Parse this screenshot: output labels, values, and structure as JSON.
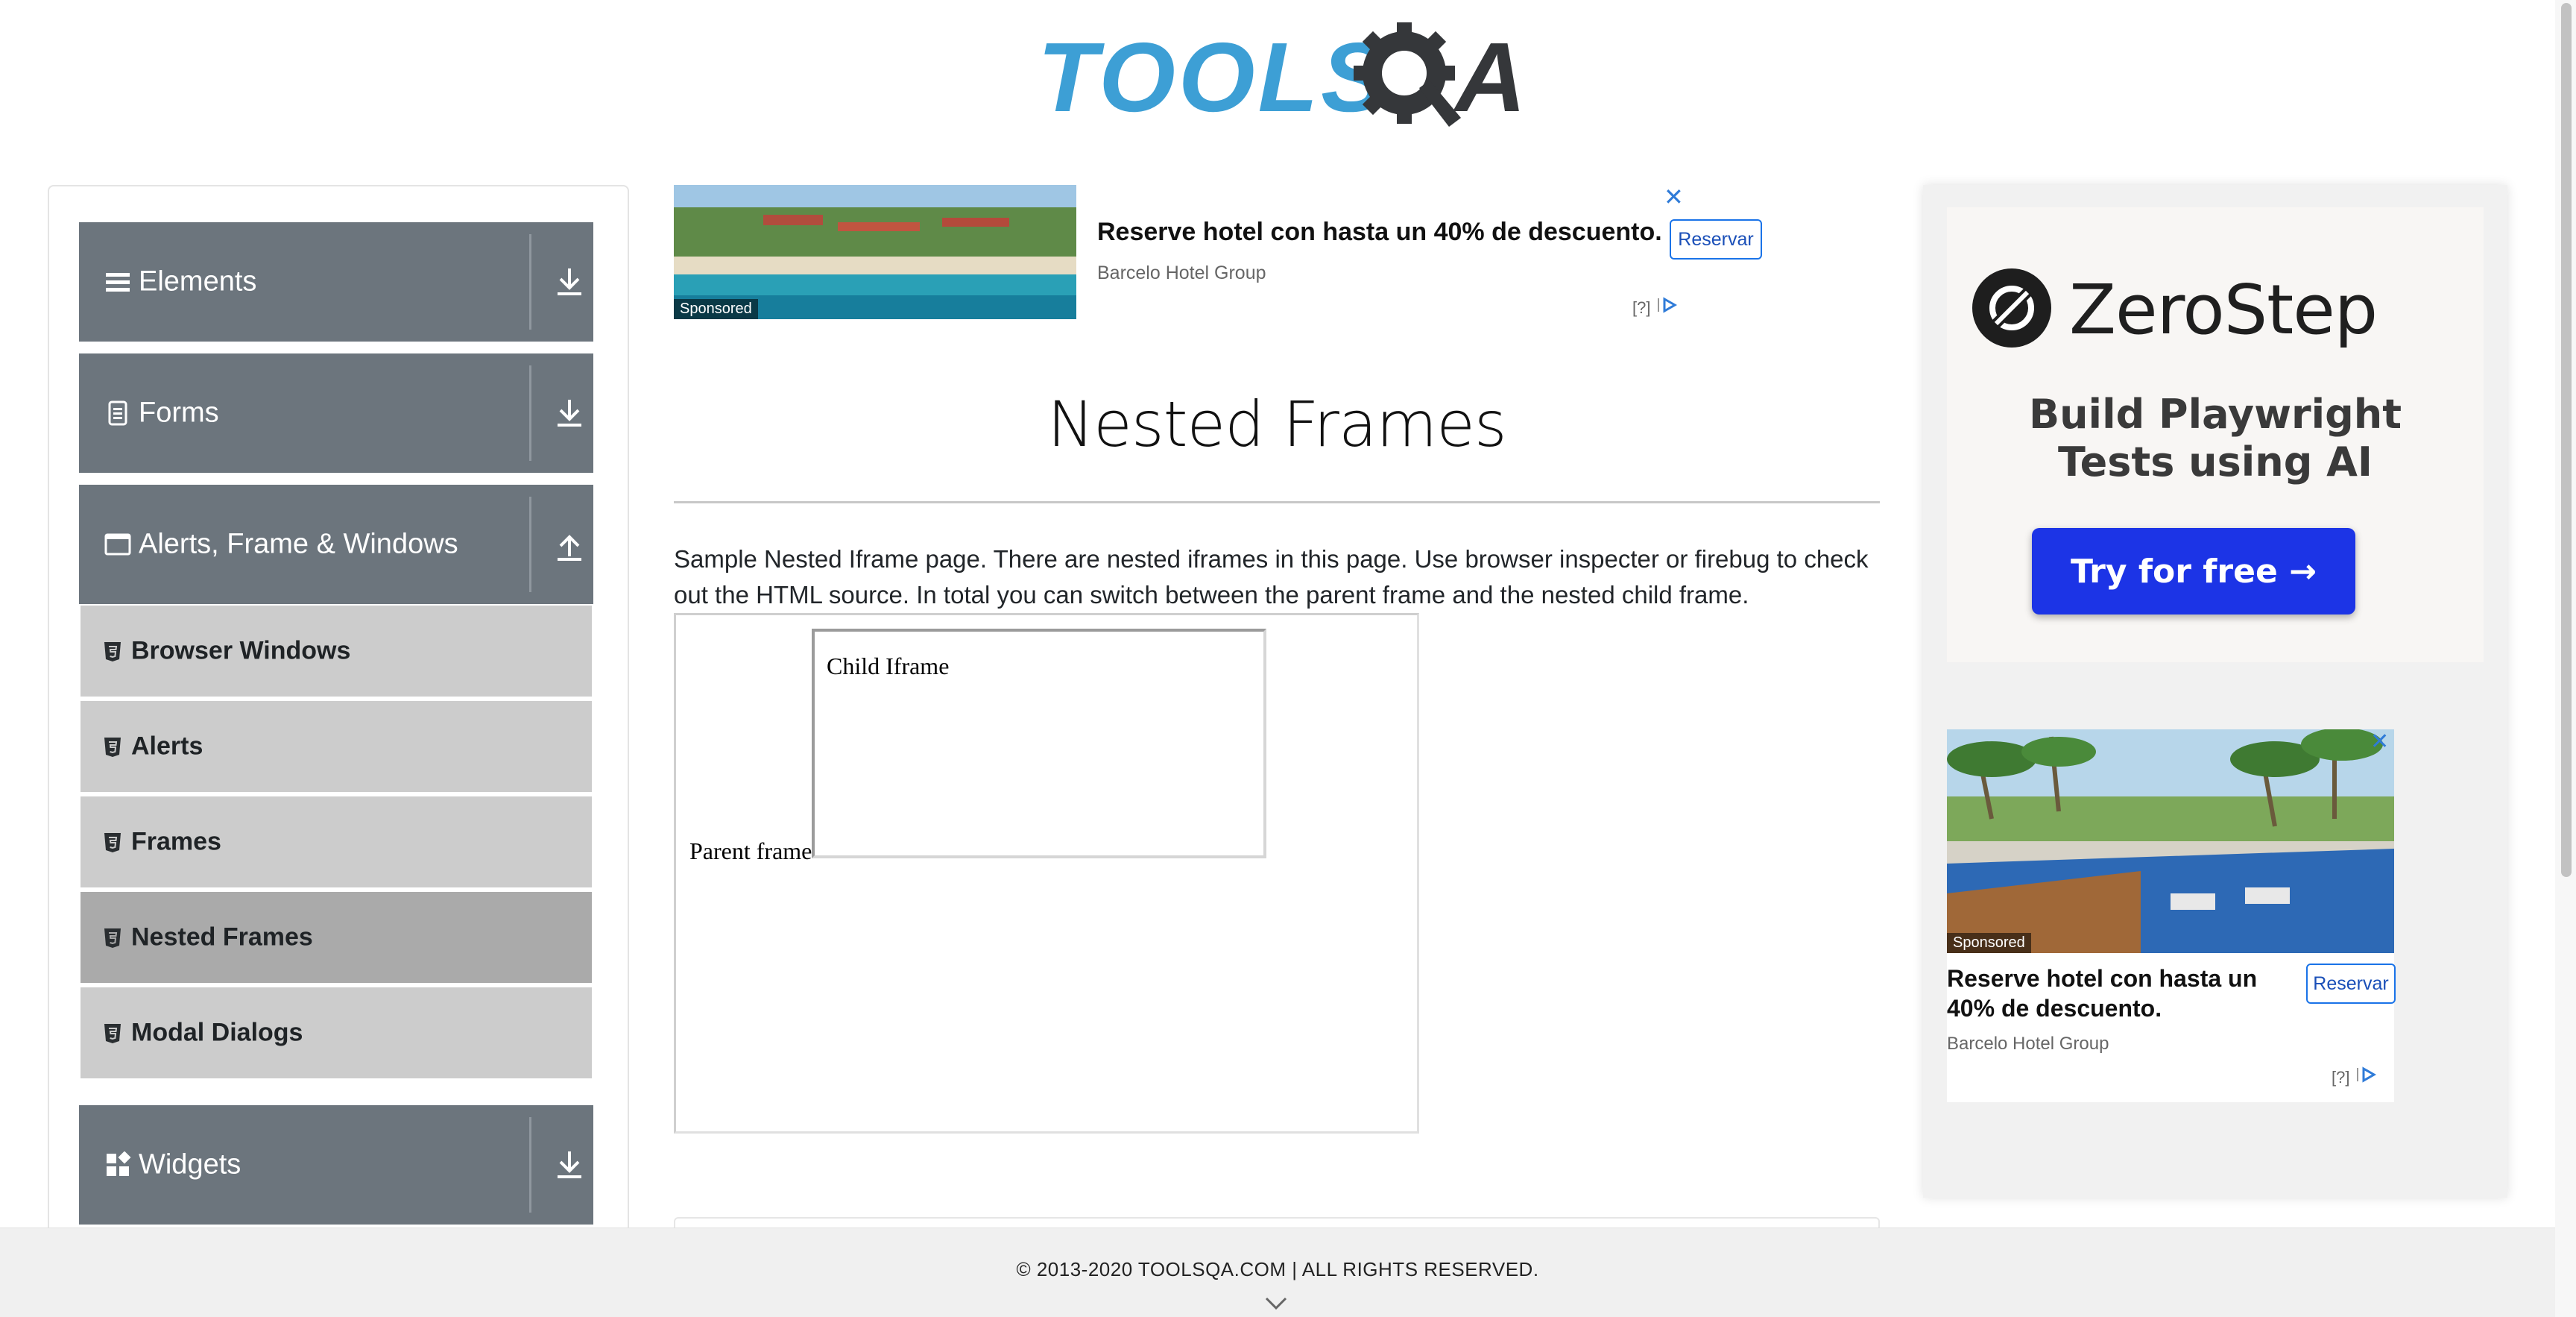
{
  "header": {
    "logo_text": "TOOLS",
    "logo_a": "A"
  },
  "sidebar": {
    "groups": [
      {
        "label": "Elements",
        "icon": "hamburger-icon",
        "arrow": "download-arrow-icon"
      },
      {
        "label": "Forms",
        "icon": "document-icon",
        "arrow": "download-arrow-icon"
      },
      {
        "label": "Alerts, Frame & Windows",
        "icon": "window-icon",
        "arrow": "upload-arrow-icon"
      },
      {
        "label": "Widgets",
        "icon": "widgets-icon",
        "arrow": "download-arrow-icon"
      }
    ],
    "items": [
      {
        "label": "Browser Windows",
        "active": false
      },
      {
        "label": "Alerts",
        "active": false
      },
      {
        "label": "Frames",
        "active": false
      },
      {
        "label": "Nested Frames",
        "active": true
      },
      {
        "label": "Modal Dialogs",
        "active": false
      }
    ]
  },
  "ad_top": {
    "title": "Reserve hotel con hasta un 40% de descuento.",
    "source": "Barcelo Hotel Group",
    "button": "Reservar",
    "sponsored": "Sponsored",
    "info": "[?]",
    "close": "✕"
  },
  "main": {
    "title": "Nested Frames",
    "description": "Sample Nested Iframe page. There are nested iframes in this page. Use browser inspecter or firebug to check out the HTML source. In total you can switch between the parent frame and the nested child frame.",
    "parent_frame_label": "Parent frame",
    "child_frame_label": "Child Iframe"
  },
  "ad_right": {
    "brand": "ZeroStep",
    "subtitle_line1": "Build Playwright",
    "subtitle_line2": "Tests using AI",
    "cta": "Try for free →"
  },
  "ad_side": {
    "title": "Reserve hotel con hasta un 40% de descuento.",
    "source": "Barcelo Hotel Group",
    "button": "Reservar",
    "sponsored": "Sponsored",
    "info": "[?]",
    "close": "✕"
  },
  "footer": {
    "text": "© 2013-2020 TOOLSQA.COM | ALL RIGHTS RESERVED."
  },
  "colors": {
    "logo_blue": "#3d9fd5",
    "sidebar_header": "#6c757d",
    "menu_item": "#cccccc",
    "menu_active": "#aaaaaa",
    "cta_blue": "#1c34e6",
    "ad_link": "#1a73e8"
  }
}
